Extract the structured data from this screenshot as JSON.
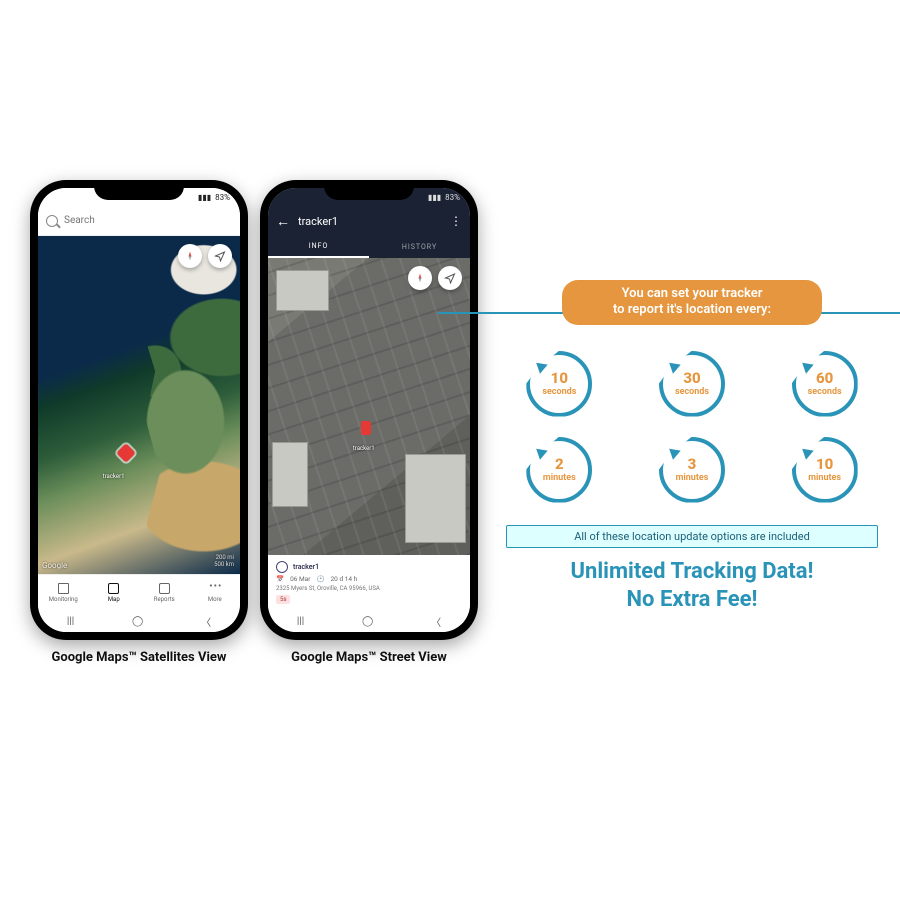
{
  "phone1": {
    "status": {
      "battery": "83%",
      "signal": "▮▮▮"
    },
    "search_placeholder": "Search",
    "pin_label": "tracker1",
    "map_attribution": "Google",
    "scale": {
      "top": "200 mi",
      "bottom": "500 km"
    },
    "nav": [
      {
        "label": "Monitoring"
      },
      {
        "label": "Map",
        "active": true
      },
      {
        "label": "Reports"
      },
      {
        "label": "More"
      }
    ],
    "caption": "Google Maps™ Satellites View"
  },
  "phone2": {
    "status": {
      "battery": "83%",
      "signal": "▮▮▮"
    },
    "title": "tracker1",
    "tabs": [
      {
        "label": "INFO",
        "active": true
      },
      {
        "label": "HISTORY"
      }
    ],
    "card": {
      "name": "tracker1",
      "date": "06 Mar",
      "duration": "20 d 14 h",
      "address": "2325 Myers St, Oroville, CA 95966, USA",
      "badge": "5s"
    },
    "caption": "Google Maps™ Street View",
    "pin_label": "tracker1"
  },
  "right": {
    "banner_line1": "You can set your tracker",
    "banner_line2": "to report it's location every:",
    "intervals": [
      {
        "num": "10",
        "unit": "seconds"
      },
      {
        "num": "30",
        "unit": "seconds"
      },
      {
        "num": "60",
        "unit": "seconds"
      },
      {
        "num": "2",
        "unit": "minutes"
      },
      {
        "num": "3",
        "unit": "minutes"
      },
      {
        "num": "10",
        "unit": "minutes"
      }
    ],
    "strip": "All of these location update options are included",
    "shout_line1": "Unlimited Tracking Data!",
    "shout_line2": "No Extra Fee!"
  }
}
